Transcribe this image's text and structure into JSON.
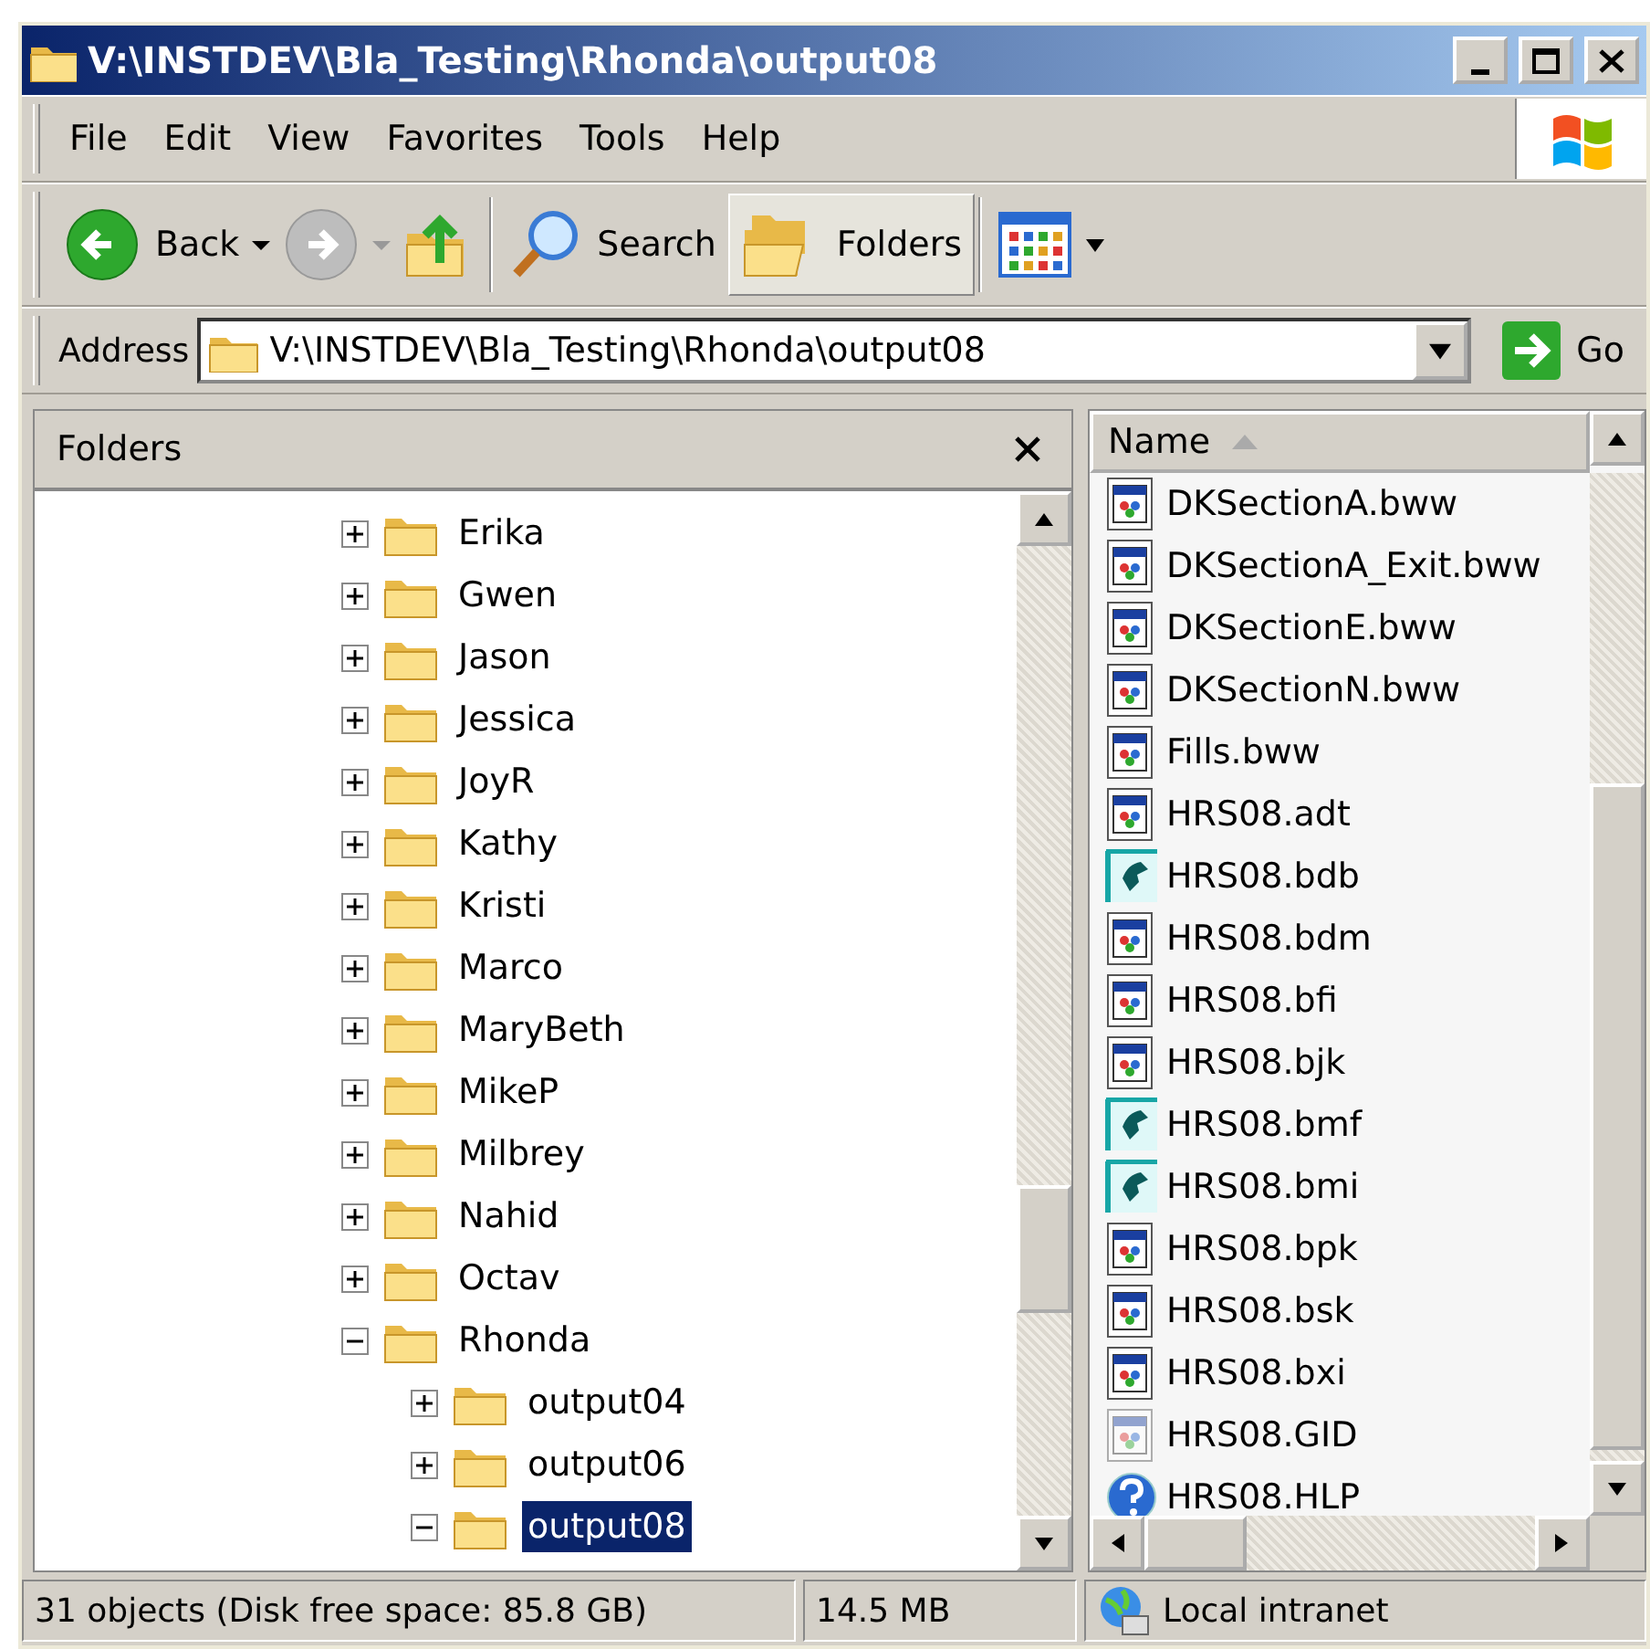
{
  "window": {
    "title": "V:\\INSTDEV\\Bla_Testing\\Rhonda\\output08"
  },
  "menu": [
    "File",
    "Edit",
    "View",
    "Favorites",
    "Tools",
    "Help"
  ],
  "toolbar": [
    {
      "kind": "back",
      "label": "Back",
      "disabled": false
    },
    {
      "kind": "forward",
      "disabled": true
    },
    {
      "kind": "up"
    },
    {
      "kind": "search",
      "label": "Search",
      "pressed": false
    },
    {
      "kind": "folders",
      "label": "Folders",
      "pressed": true
    },
    {
      "kind": "views"
    }
  ],
  "address": {
    "label": "Address",
    "value": "V:\\INSTDEV\\Bla_Testing\\Rhonda\\output08",
    "go_label": "Go"
  },
  "folders_pane": {
    "title": "Folders",
    "tree": [
      {
        "label": "Erika",
        "expanded": false,
        "selected": false
      },
      {
        "label": "Gwen",
        "expanded": false,
        "selected": false
      },
      {
        "label": "Jason",
        "expanded": false,
        "selected": false
      },
      {
        "label": "Jessica",
        "expanded": false,
        "selected": false
      },
      {
        "label": "JoyR",
        "expanded": false,
        "selected": false
      },
      {
        "label": "Kathy",
        "expanded": false,
        "selected": false
      },
      {
        "label": "Kristi",
        "expanded": false,
        "selected": false
      },
      {
        "label": "Marco",
        "expanded": false,
        "selected": false
      },
      {
        "label": "MaryBeth",
        "expanded": false,
        "selected": false
      },
      {
        "label": "MikeP",
        "expanded": false,
        "selected": false
      },
      {
        "label": "Milbrey",
        "expanded": false,
        "selected": false
      },
      {
        "label": "Nahid",
        "expanded": false,
        "selected": false
      },
      {
        "label": "Octav",
        "expanded": false,
        "selected": false
      },
      {
        "label": "Rhonda",
        "expanded": true,
        "selected": false,
        "children": [
          {
            "label": "output04",
            "expanded": false,
            "selected": false
          },
          {
            "label": "output06",
            "expanded": false,
            "selected": false
          },
          {
            "label": "output08",
            "expanded": true,
            "selected": true
          }
        ]
      }
    ]
  },
  "file_list": {
    "column": "Name",
    "sort_ascending": true,
    "files": [
      {
        "name": "DKSectionA.bww",
        "kind": "app"
      },
      {
        "name": "DKSectionA_Exit.bww",
        "kind": "app"
      },
      {
        "name": "DKSectionE.bww",
        "kind": "app"
      },
      {
        "name": "DKSectionN.bww",
        "kind": "app"
      },
      {
        "name": "Fills.bww",
        "kind": "app"
      },
      {
        "name": "HRS08.adt",
        "kind": "app"
      },
      {
        "name": "HRS08.bdb",
        "kind": "teal"
      },
      {
        "name": "HRS08.bdm",
        "kind": "app"
      },
      {
        "name": "HRS08.bfi",
        "kind": "app"
      },
      {
        "name": "HRS08.bjk",
        "kind": "app"
      },
      {
        "name": "HRS08.bmf",
        "kind": "teal"
      },
      {
        "name": "HRS08.bmi",
        "kind": "teal"
      },
      {
        "name": "HRS08.bpk",
        "kind": "app"
      },
      {
        "name": "HRS08.bsk",
        "kind": "app"
      },
      {
        "name": "HRS08.bxi",
        "kind": "app"
      },
      {
        "name": "HRS08.GID",
        "kind": "faded"
      },
      {
        "name": "HRS08.HLP",
        "kind": "help"
      }
    ]
  },
  "status_bar": [
    "31 objects (Disk free space: 85.8 GB)",
    "14.5 MB",
    "Local intranet"
  ]
}
